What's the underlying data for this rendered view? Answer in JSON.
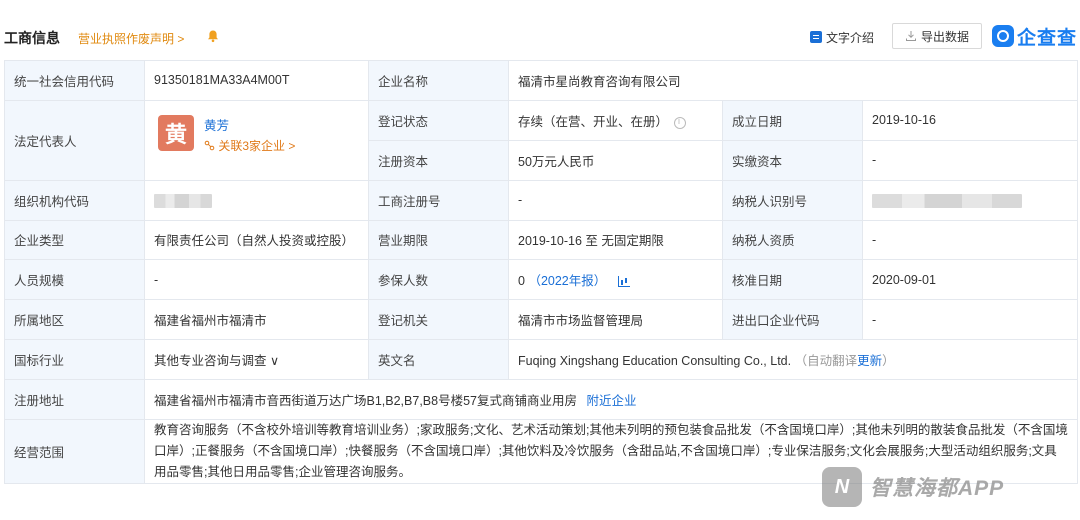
{
  "header": {
    "title": "工商信息",
    "notice_link": "营业执照作废声明 >",
    "text_intro": "文字介绍",
    "export": "导出数据",
    "logo_text": "企查查",
    "icons": {
      "bell": "bell-icon",
      "doc": "doc-icon",
      "download": "download-icon",
      "logo": "qichacha-logo-icon"
    }
  },
  "rows": {
    "credit_code_label": "统一社会信用代码",
    "credit_code": "91350181MA33A4M00T",
    "company_name_label": "企业名称",
    "company_name": "福清市星尚教育咨询有限公司",
    "legal_rep_label": "法定代表人",
    "legal_rep_avatar": "黄",
    "legal_rep_name": "黄芳",
    "legal_rep_related": "关联3家企业 >",
    "reg_status_label": "登记状态",
    "reg_status": "存续（在营、开业、在册）",
    "founded_label": "成立日期",
    "founded": "2019-10-16",
    "reg_capital_label": "注册资本",
    "reg_capital": "50万元人民币",
    "paid_capital_label": "实缴资本",
    "paid_capital": "-",
    "org_code_label": "组织机构代码",
    "biz_reg_no_label": "工商注册号",
    "biz_reg_no": "-",
    "taxpayer_id_label": "纳税人识别号",
    "company_type_label": "企业类型",
    "company_type": "有限责任公司（自然人投资或控股）",
    "biz_term_label": "营业期限",
    "biz_term": "2019-10-16 至 无固定期限",
    "taxpayer_qual_label": "纳税人资质",
    "taxpayer_qual": "-",
    "staff_size_label": "人员规模",
    "staff_size": "-",
    "insured_label": "参保人数",
    "insured": "0",
    "insured_year": "（2022年报）",
    "approval_date_label": "核准日期",
    "approval_date": "2020-09-01",
    "region_label": "所属地区",
    "region": "福建省福州市福清市",
    "reg_authority_label": "登记机关",
    "reg_authority": "福清市市场监督管理局",
    "import_export_label": "进出口企业代码",
    "import_export": "-",
    "industry_label": "国标行业",
    "industry": "其他专业咨询与调查 ∨",
    "english_name_label": "英文名",
    "english_name": "Fuqing Xingshang Education Consulting Co., Ltd.",
    "auto_translate": "（自动翻译",
    "update": "更新",
    "auto_translate_end": "）",
    "address_label": "注册地址",
    "address": "福建省福州市福清市音西街道万达广场B1,B2,B7,B8号楼57复式商铺商业用房",
    "nearby": "附近企业",
    "scope_label": "经营范围",
    "scope": "教育咨询服务（不含校外培训等教育培训业务）;家政服务;文化、艺术活动策划;其他未列明的预包装食品批发（不含国境口岸）;其他未列明的散装食品批发（不含国境口岸）;正餐服务（不含国境口岸）;快餐服务（不含国境口岸）;其他饮料及冷饮服务（含甜品站,不含国境口岸）;专业保洁服务;文化会展服务;大型活动组织服务;文具用品零售;其他日用品零售;企业管理咨询服务。"
  },
  "watermark": {
    "mark": "N",
    "text": "智慧海都APP"
  },
  "colors": {
    "accent": "#1a6fd6",
    "label_bg": "#f2f7fd",
    "border": "#e4e8ee",
    "orange": "#e07a1a",
    "avatar": "#e27a5f"
  }
}
